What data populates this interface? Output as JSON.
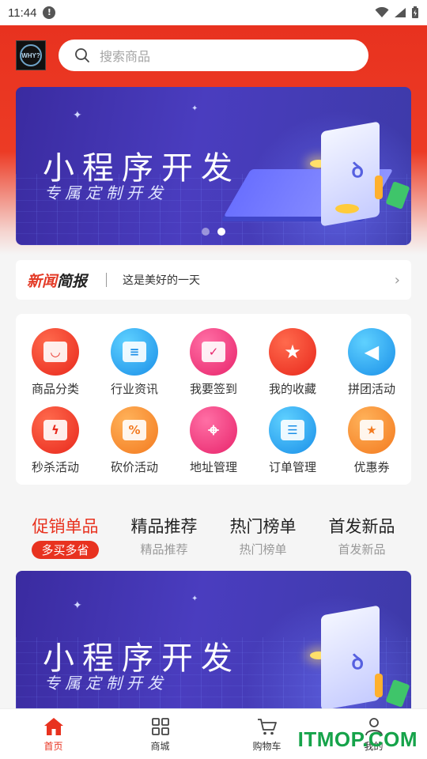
{
  "status_bar": {
    "time": "11:44",
    "alert_glyph": "!"
  },
  "header": {
    "logo_text": "WHY?",
    "search_placeholder": "搜索商品"
  },
  "banner": {
    "title": "小程序开发",
    "subtitle": "专属定制开发",
    "dot_count": 2,
    "active_dot": 2
  },
  "news": {
    "logo_red": "新闻",
    "logo_black": "简报",
    "text": "这是美好的一天",
    "chevron": "›"
  },
  "categories": [
    {
      "label": "商品分类",
      "icon": "shopping-bag-icon",
      "color": "red"
    },
    {
      "label": "行业资讯",
      "icon": "document-icon",
      "color": "blue"
    },
    {
      "label": "我要签到",
      "icon": "calendar-check-icon",
      "color": "pink"
    },
    {
      "label": "我的收藏",
      "icon": "star-icon",
      "color": "red"
    },
    {
      "label": "拼团活动",
      "icon": "megaphone-icon",
      "color": "blue"
    },
    {
      "label": "秒杀活动",
      "icon": "lightning-icon",
      "color": "red"
    },
    {
      "label": "砍价活动",
      "icon": "percent-tag-icon",
      "color": "orange"
    },
    {
      "label": "地址管理",
      "icon": "location-pin-icon",
      "color": "pink"
    },
    {
      "label": "订单管理",
      "icon": "order-list-icon",
      "color": "blue"
    },
    {
      "label": "优惠券",
      "icon": "coupon-icon",
      "color": "orange"
    }
  ],
  "tabs": [
    {
      "title": "促销单品",
      "subtitle": "多买多省",
      "active": true
    },
    {
      "title": "精品推荐",
      "subtitle": "精品推荐",
      "active": false
    },
    {
      "title": "热门榜单",
      "subtitle": "热门榜单",
      "active": false
    },
    {
      "title": "首发新品",
      "subtitle": "首发新品",
      "active": false
    }
  ],
  "bottom_nav": [
    {
      "label": "首页",
      "icon": "home-icon",
      "active": true
    },
    {
      "label": "商城",
      "icon": "grid-icon",
      "active": false
    },
    {
      "label": "购物车",
      "icon": "cart-icon",
      "active": false
    },
    {
      "label": "我的",
      "icon": "user-icon",
      "active": false
    }
  ],
  "watermark": "ITMOP.COM",
  "colors": {
    "brand_red": "#e8321f",
    "watermark_green": "#16a34a"
  }
}
